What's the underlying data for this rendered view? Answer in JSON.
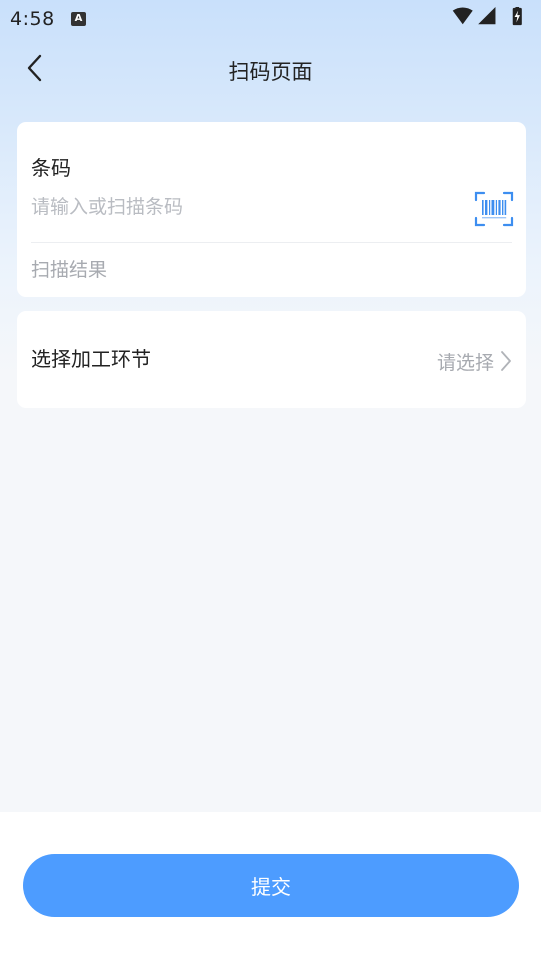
{
  "status_bar": {
    "time": "4:58",
    "notification_badge": "A"
  },
  "nav": {
    "title": "扫码页面"
  },
  "barcode_card": {
    "label": "条码",
    "input_placeholder": "请输入或扫描条码",
    "input_value": "",
    "result_label": "扫描结果"
  },
  "process_card": {
    "label": "选择加工环节",
    "select_placeholder": "请选择"
  },
  "footer": {
    "submit_label": "提交"
  },
  "colors": {
    "primary": "#4d9cff",
    "scan_icon": "#3d8ef0",
    "placeholder": "#b9bcc2",
    "text": "#222222"
  }
}
